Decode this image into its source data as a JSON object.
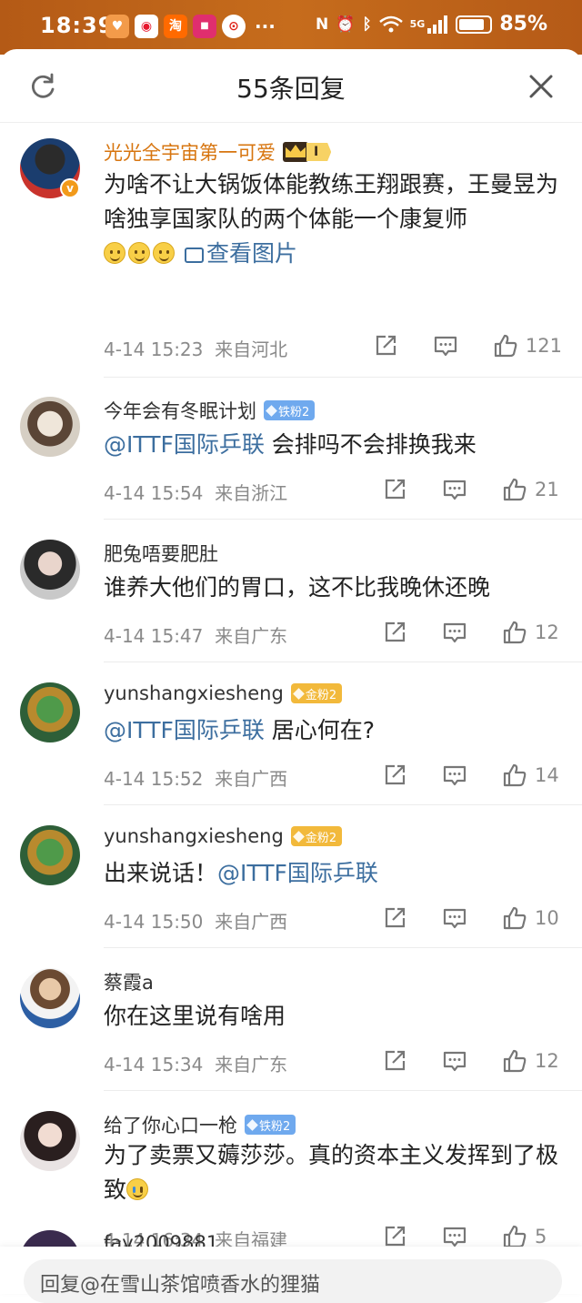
{
  "status_bar": {
    "time": "18:39",
    "network": "5G",
    "battery_level": 0.85,
    "battery_text": "85%",
    "app_icons": [
      "shield-app-icon",
      "weibo-app-icon",
      "taobao-app-icon",
      "shop-app-icon",
      "alarm-app-icon"
    ],
    "more": "···"
  },
  "header": {
    "title": "55条回复"
  },
  "comments": [
    {
      "user": "光光全宇宙第一可爱",
      "badge_type": "crown",
      "badge_label": "I",
      "verified": true,
      "text_parts": [
        "为啥不让大锅饭体能教练王翔跟赛，王曼昱为啥独享国家队的两个体能一个康复师"
      ],
      "emoji_count": 3,
      "image_link": "查看图片",
      "time": "4-14 15:23",
      "location": "来自河北",
      "likes": "121"
    },
    {
      "user": "今年会有冬眠计划",
      "badge_type": "iron",
      "badge_label": "铁粉2",
      "mention": "@ITTF国际乒联",
      "text": " 会排吗不会排换我来",
      "time": "4-14 15:54",
      "location": "来自浙江",
      "likes": "21"
    },
    {
      "user": "肥兔唔要肥肚",
      "text": "谁养大他们的胃口，这不比我晚休还晚",
      "time": "4-14 15:47",
      "location": "来自广东",
      "likes": "12"
    },
    {
      "user": "yunshangxiesheng",
      "badge_type": "gold",
      "badge_label": "金粉2",
      "mention": "@ITTF国际乒联",
      "text": " 居心何在?",
      "time": "4-14 15:52",
      "location": "来自广西",
      "likes": "14"
    },
    {
      "user": "yunshangxiesheng",
      "badge_type": "gold",
      "badge_label": "金粉2",
      "text_before": "出来说话！",
      "mention": "@ITTF国际乒联",
      "time": "4-14 15:50",
      "location": "来自广西",
      "likes": "10"
    },
    {
      "user": "蔡霞a",
      "text": "你在这里说有啥用",
      "time": "4-14 15:34",
      "location": "来自广东",
      "likes": "12"
    },
    {
      "user": "给了你心口一枪",
      "badge_type": "iron",
      "badge_label": "铁粉2",
      "text": "为了卖票又薅莎莎。真的资本主义发挥到了极致",
      "emoji": "cry",
      "time": "4-14 16:34",
      "location": "来自福建",
      "likes": "5"
    }
  ],
  "peek_comment": {
    "user": "fay2009881"
  },
  "reply_bar": {
    "text": "回复@在雪山茶馆喷香水的狸猫"
  },
  "colors": {
    "status_bar": "#c0641a",
    "vip_name": "#d7750f",
    "mention": "#3c6e9f",
    "iron_badge": "#6fa9ee",
    "gold_badge": "#f2b93b",
    "meta": "#8a8a8a"
  }
}
